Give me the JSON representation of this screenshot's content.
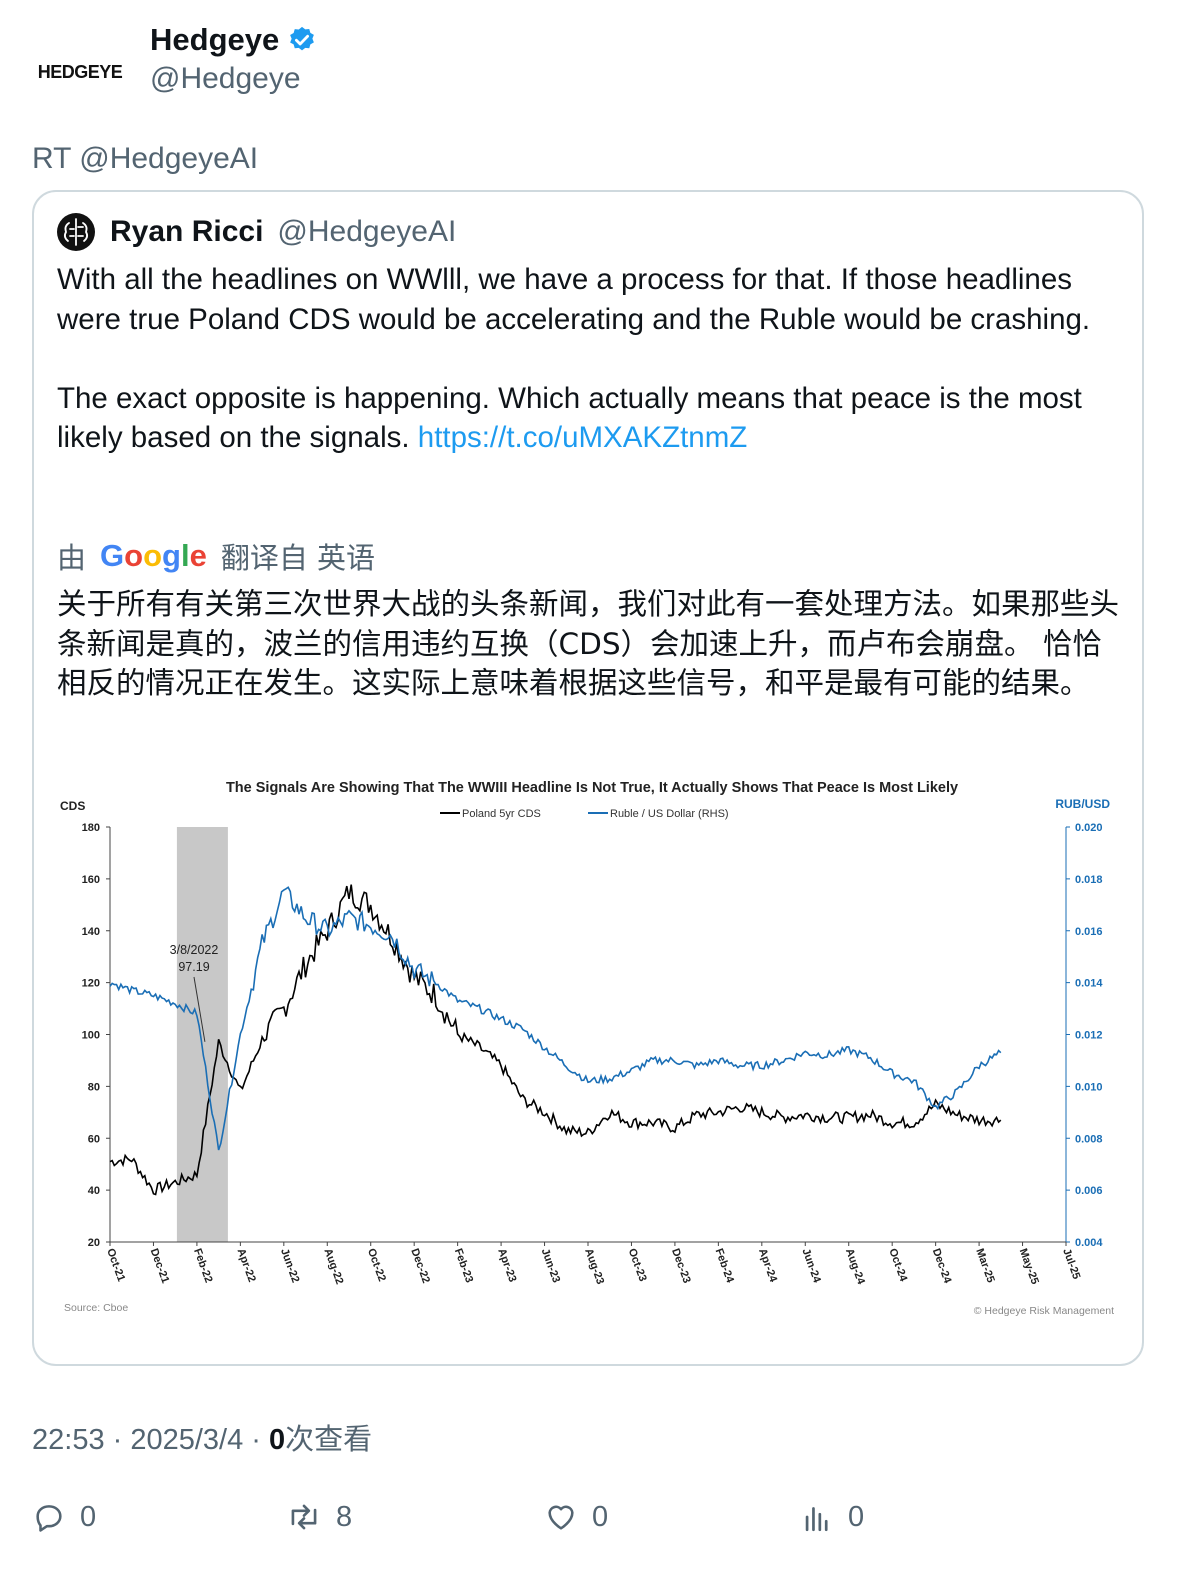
{
  "author": {
    "logo_text": "HEDGEYE",
    "name": "Hedgeye",
    "handle": "@Hedgeye"
  },
  "retweet_label": "RT @HedgeyeAI",
  "quoted": {
    "name": "Ryan Ricci",
    "handle": "@HedgeyeAI",
    "text_1": "With all the headlines on WWlll, we have a process for that. If those headlines were true Poland CDS would be accelerating and the Ruble would be crashing.",
    "text_2": "The exact opposite is happening. Which actually means that peace is the most likely based on the signals. ",
    "link": "https://t.co/uMXAKZtnmZ",
    "translation_prefix": "由",
    "translation_suffix": "翻译自 英语",
    "google_letters": [
      "G",
      "o",
      "o",
      "g",
      "l",
      "e"
    ],
    "translation": "关于所有有关第三次世界大战的头条新闻，我们对此有一套处理方法。如果那些头条新闻是真的，波兰的信用违约互换（CDS）会加速上升，而卢布会崩盘。 恰恰相反的情况正在发生。这实际上意味着根据这些信号，和平是最有可能的结果。"
  },
  "chart_data": {
    "type": "line",
    "title": "The Signals Are Showing That The WWIII Headline Is Not True, It Actually Shows That Peace Is Most Likely",
    "ylabel_left": "CDS",
    "ylabel_right": "RUB/USD",
    "ylim_left": [
      20,
      180
    ],
    "ylim_right": [
      0.004,
      0.02
    ],
    "yticks_left": [
      "180",
      "160",
      "140",
      "120",
      "100",
      "80",
      "60",
      "40",
      "20"
    ],
    "yticks_right": [
      "0.020",
      "0.018",
      "0.016",
      "0.014",
      "0.012",
      "0.010",
      "0.008",
      "0.006",
      "0.004"
    ],
    "x_ticks": [
      "Oct-21",
      "Dec-21",
      "Feb-22",
      "Apr-22",
      "Jun-22",
      "Aug-22",
      "Oct-22",
      "Dec-22",
      "Feb-23",
      "Apr-23",
      "Jun-23",
      "Aug-23",
      "Oct-23",
      "Dec-23",
      "Feb-24",
      "Apr-24",
      "Jun-24",
      "Aug-24",
      "Oct-24",
      "Dec-24",
      "Mar-25",
      "May-25",
      "Jul-25"
    ],
    "annotation": {
      "date": "3/8/2022",
      "value": "97.19"
    },
    "shaded_region": [
      "Feb-22",
      "Mar-22"
    ],
    "source": "Source: Cboe",
    "copyright": "© Hedgeye Risk Management",
    "series": [
      {
        "name": "Poland 5yr CDS",
        "axis": "left",
        "color": "#000000",
        "x": [
          "Oct-21",
          "Nov-21",
          "Dec-21",
          "Jan-22",
          "Feb-22",
          "Mar-22",
          "Apr-22",
          "May-22",
          "Jun-22",
          "Jul-22",
          "Aug-22",
          "Sep-22",
          "Oct-22",
          "Nov-22",
          "Dec-22",
          "Jan-23",
          "Feb-23",
          "Mar-23",
          "Apr-23",
          "May-23",
          "Jun-23",
          "Jul-23",
          "Aug-23",
          "Sep-23",
          "Oct-23",
          "Nov-23",
          "Dec-23",
          "Jan-24",
          "Feb-24",
          "Mar-24",
          "Apr-24",
          "May-24",
          "Jun-24",
          "Jul-24",
          "Aug-24",
          "Sep-24",
          "Oct-24",
          "Nov-24",
          "Dec-24",
          "Jan-25",
          "Feb-25",
          "Mar-25"
        ],
        "values": [
          51,
          52,
          40,
          43,
          46,
          97,
          78,
          98,
          110,
          127,
          140,
          155,
          150,
          137,
          122,
          115,
          100,
          95,
          88,
          75,
          70,
          63,
          62,
          70,
          66,
          66,
          64,
          69,
          70,
          72,
          70,
          68,
          69,
          68,
          68,
          69,
          66,
          66,
          73,
          69,
          67,
          67
        ]
      },
      {
        "name": "Ruble / US Dollar (RHS)",
        "axis": "right",
        "color": "#1a6eb5",
        "x": [
          "Oct-21",
          "Nov-21",
          "Dec-21",
          "Jan-22",
          "Feb-22",
          "Mar-22",
          "Apr-22",
          "May-22",
          "Jun-22",
          "Jul-22",
          "Aug-22",
          "Sep-22",
          "Oct-22",
          "Nov-22",
          "Dec-22",
          "Jan-23",
          "Feb-23",
          "Mar-23",
          "Apr-23",
          "May-23",
          "Jun-23",
          "Jul-23",
          "Aug-23",
          "Sep-23",
          "Oct-23",
          "Nov-23",
          "Dec-23",
          "Jan-24",
          "Feb-24",
          "Mar-24",
          "Apr-24",
          "May-24",
          "Jun-24",
          "Jul-24",
          "Aug-24",
          "Sep-24",
          "Oct-24",
          "Nov-24",
          "Dec-24",
          "Jan-25",
          "Feb-25",
          "Mar-25"
        ],
        "values": [
          0.014,
          0.0137,
          0.0135,
          0.0132,
          0.0128,
          0.0075,
          0.012,
          0.0155,
          0.0175,
          0.0165,
          0.016,
          0.0165,
          0.0162,
          0.0158,
          0.0145,
          0.014,
          0.0133,
          0.013,
          0.0126,
          0.0122,
          0.0115,
          0.0108,
          0.0102,
          0.0103,
          0.0106,
          0.011,
          0.011,
          0.0108,
          0.011,
          0.0108,
          0.0108,
          0.011,
          0.0113,
          0.0112,
          0.0114,
          0.0111,
          0.0105,
          0.0102,
          0.0092,
          0.0098,
          0.0108,
          0.0113
        ]
      }
    ]
  },
  "meta": {
    "time": "22:53 · 2025/3/4 · ",
    "views_count": "0",
    "views_label": "次查看"
  },
  "actions": {
    "replies": "0",
    "retweets": "8",
    "likes": "0",
    "views": "0"
  }
}
